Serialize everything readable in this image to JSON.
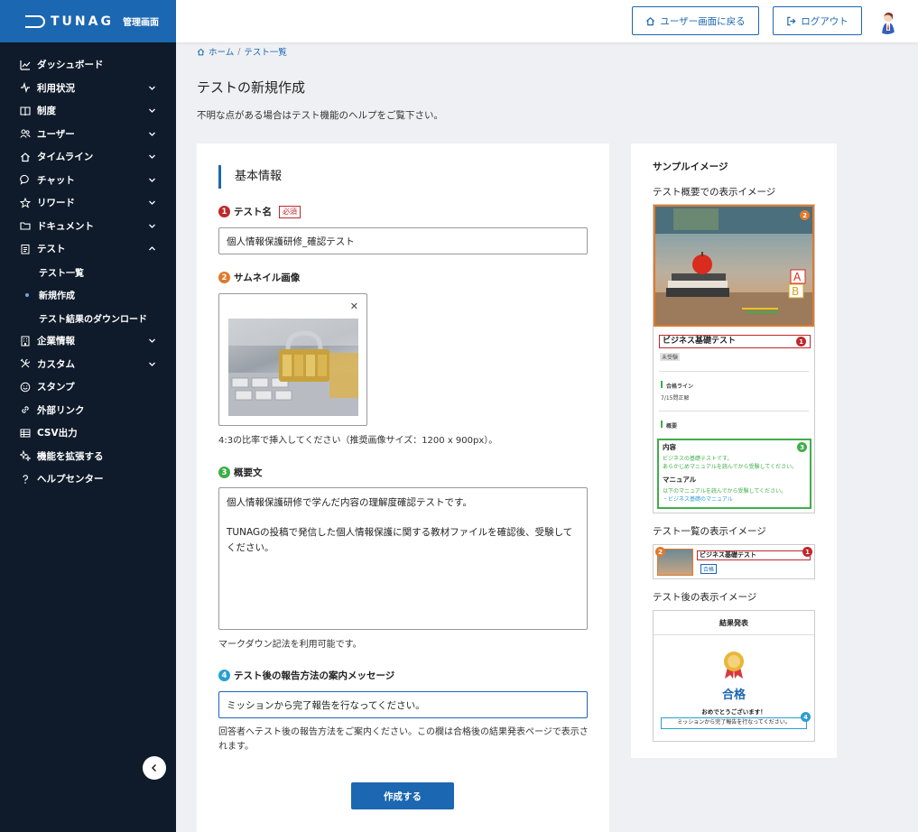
{
  "brand": {
    "name": "TUNAG",
    "sub": "管理画面"
  },
  "sidebar": {
    "items": [
      {
        "label": "ダッシュボード",
        "icon": "chart-line-icon",
        "chevron": false
      },
      {
        "label": "利用状況",
        "icon": "pulse-icon",
        "chevron": "down"
      },
      {
        "label": "制度",
        "icon": "book-icon",
        "chevron": "down"
      },
      {
        "label": "ユーザー",
        "icon": "users-icon",
        "chevron": "down"
      },
      {
        "label": "タイムライン",
        "icon": "home-icon",
        "chevron": "down"
      },
      {
        "label": "チャット",
        "icon": "chat-bubble-icon",
        "chevron": "down"
      },
      {
        "label": "リワード",
        "icon": "star-icon",
        "chevron": "down"
      },
      {
        "label": "ドキュメント",
        "icon": "folder-icon",
        "chevron": "down"
      },
      {
        "label": "テスト",
        "icon": "clipboard-icon",
        "chevron": "up"
      }
    ],
    "sub_items": [
      {
        "label": "テスト一覧",
        "active": false
      },
      {
        "label": "新規作成",
        "active": true
      },
      {
        "label": "テスト結果のダウンロード",
        "active": false
      }
    ],
    "items_after": [
      {
        "label": "企業情報",
        "icon": "building-icon",
        "chevron": "down"
      },
      {
        "label": "カスタム",
        "icon": "tools-icon",
        "chevron": "down"
      },
      {
        "label": "スタンプ",
        "icon": "smile-icon",
        "chevron": false
      },
      {
        "label": "外部リンク",
        "icon": "link-icon",
        "chevron": false
      },
      {
        "label": "CSV出力",
        "icon": "table-icon",
        "chevron": false
      },
      {
        "label": "機能を拡張する",
        "icon": "sparkle-icon",
        "chevron": false
      },
      {
        "label": "ヘルプセンター",
        "icon": "question-icon",
        "chevron": false
      }
    ]
  },
  "header": {
    "user_screen_label": "ユーザー画面に戻る",
    "logout_label": "ログアウト"
  },
  "breadcrumb": {
    "home": "ホーム",
    "sep": "/",
    "current": "テスト一覧"
  },
  "page": {
    "title": "テストの新規作成",
    "description": "不明な点がある場合はテスト機能のヘルプをご覧下さい。"
  },
  "form": {
    "section_title": "基本情報",
    "name": {
      "num": "1",
      "label": "テスト名",
      "required": "必須",
      "value": "個人情報保護研修_確認テスト"
    },
    "thumbnail": {
      "num": "2",
      "label": "サムネイル画像",
      "help": "4:3の比率で挿入してください（推奨画像サイズ：1200 x 900px）。"
    },
    "summary": {
      "num": "3",
      "label": "概要文",
      "value": "個人情報保護研修で学んだ内容の理解度確認テストです。\n\nTUNAGの投稿で発信した個人情報保護に関する教材ファイルを確認後、受験してください。",
      "help": "マークダウン記法を利用可能です。"
    },
    "report": {
      "num": "4",
      "label": "テスト後の報告方法の案内メッセージ",
      "value": "ミッションから完了報告を行なってください。",
      "help": "回答者へテスト後の報告方法をご案内ください。この欄は合格後の結果発表ページで表示されます。"
    },
    "submit_label": "作成する"
  },
  "sample": {
    "title": "サンプルイメージ",
    "overview_label": "テスト概要での表示イメージ",
    "list_label": "テスト一覧の表示イメージ",
    "after_label": "テスト後の表示イメージ",
    "preview": {
      "test_title": "ビジネス基礎テスト",
      "status": "未受験",
      "pass_line_label": "合格ライン",
      "pass_line_value": "7/15問正解",
      "summary_label": "概要",
      "content_label": "内容",
      "content_text1": "ビジネスの基礎テストです。",
      "content_text2": "あらかじめマニュアルを読んでから受験してください。",
      "manual_label": "マニュアル",
      "manual_text": "以下のマニュアルを読んでから受験してください。",
      "manual_link": "・ビジネス基礎のマニュアル",
      "list_badge": "合格",
      "result_title": "結果発表",
      "result_pass": "合格",
      "result_congrats": "おめでとうございます！",
      "result_message": "ミッションから完了報告を行なってください。"
    }
  },
  "colors": {
    "accent": "#1c67b1",
    "sidebar_bg": "#0f1b2a",
    "required": "#c0282b"
  }
}
